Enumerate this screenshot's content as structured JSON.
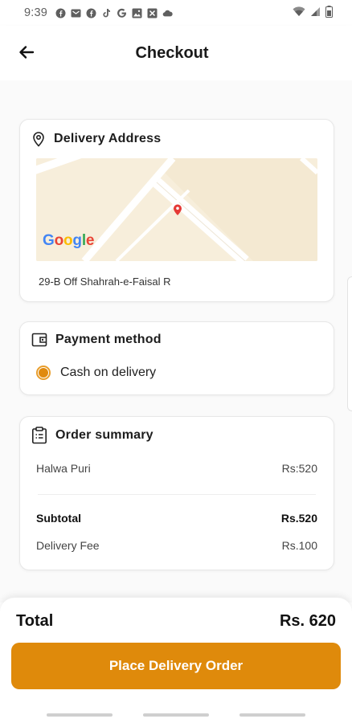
{
  "status_bar": {
    "time": "9:39",
    "left_icons": [
      "facebook-icon",
      "mail-icon",
      "facebook-icon",
      "tiktok-icon",
      "google-icon",
      "image-icon",
      "x-close-box-icon",
      "cloud-icon"
    ],
    "right_icons": [
      "wifi-icon",
      "signal-icon",
      "battery-icon"
    ]
  },
  "header": {
    "title": "Checkout",
    "back_icon": "arrow-left-icon"
  },
  "delivery_address": {
    "title": "Delivery Address",
    "icon": "location-pin-icon",
    "map_logo": "Google",
    "address": "29-B Off Shahrah-e-Faisal R",
    "colors": {
      "map_bg": "#f7eedb",
      "marker": "#e53935"
    }
  },
  "payment": {
    "title": "Payment method",
    "icon": "wallet-icon",
    "option": "Cash on delivery",
    "selected": true
  },
  "order_summary": {
    "title": "Order summary",
    "icon": "clipboard-icon",
    "items": [
      {
        "name": "Halwa Puri",
        "price": "Rs:520"
      }
    ],
    "subtotal_label": "Subtotal",
    "subtotal_value": "Rs.520",
    "delivery_fee_label": "Delivery Fee",
    "delivery_fee_value": "Rs.100"
  },
  "footer": {
    "total_label": "Total",
    "total_value": "Rs. 620",
    "button_label": "Place Delivery Order"
  },
  "colors": {
    "accent": "#df8a0b",
    "card_border": "#e7e7e7"
  }
}
